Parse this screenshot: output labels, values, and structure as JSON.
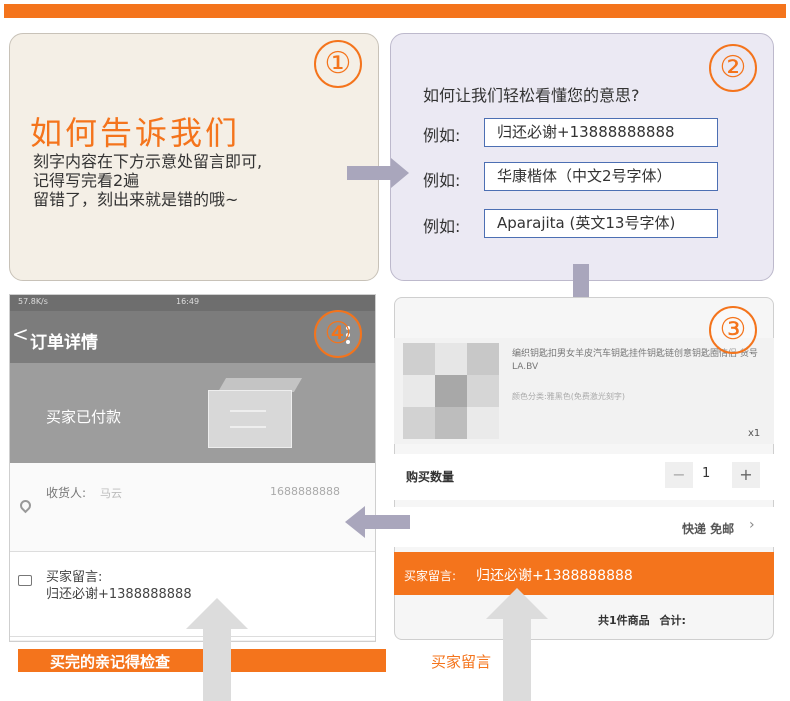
{
  "panel1": {
    "step": "①",
    "title": "如何告诉我们",
    "lines": [
      "刻字内容在下方示意处留言即可,",
      "记得写完看2遍",
      "留错了，刻出来就是错的哦~"
    ]
  },
  "panel2": {
    "step": "②",
    "question": "如何让我们轻松看懂您的意思?",
    "examples": [
      {
        "label": "例如:",
        "text": "归还必谢+13888888888"
      },
      {
        "label": "例如:",
        "text": "华康楷体（中文2号字体）"
      },
      {
        "label": "例如:",
        "text": "Aparajita (英文13号字体)"
      }
    ]
  },
  "panel3": {
    "step": "③",
    "product_name": "编织钥匙扣男女羊皮汽车钥匙挂件钥匙链创意钥匙圈情侣 货号LA.BV",
    "product_spec": "颜色分类:雅黑色(免费激光刻字)",
    "quantity_x": "x1",
    "qty_label": "购买数量",
    "qty_minus": "−",
    "qty_value": "1",
    "qty_plus": "+",
    "shipping": "快递 免邮",
    "msg_label": "买家留言:",
    "msg_text": "归还必谢+1388888888",
    "total": "共1件商品 合计:"
  },
  "panel4": {
    "step": "④",
    "status_left": "57.8K/s",
    "status_time": "16:49",
    "back": "<",
    "title": "订单详情",
    "paid": "买家已付款",
    "receiver_label": "收货人:",
    "receiver_name": "马云",
    "receiver_phone": "1688888888",
    "msg_label": "买家留言:",
    "msg_text": "归还必谢+1388888888"
  },
  "bottom": {
    "left_label": "买完的亲记得检查",
    "right_label": "买家留言"
  },
  "colors": {
    "accent": "#f4741c",
    "arrow": "#a9a6bc",
    "panel1_bg": "#f4efe6",
    "panel2_bg": "#ebe9f3"
  }
}
